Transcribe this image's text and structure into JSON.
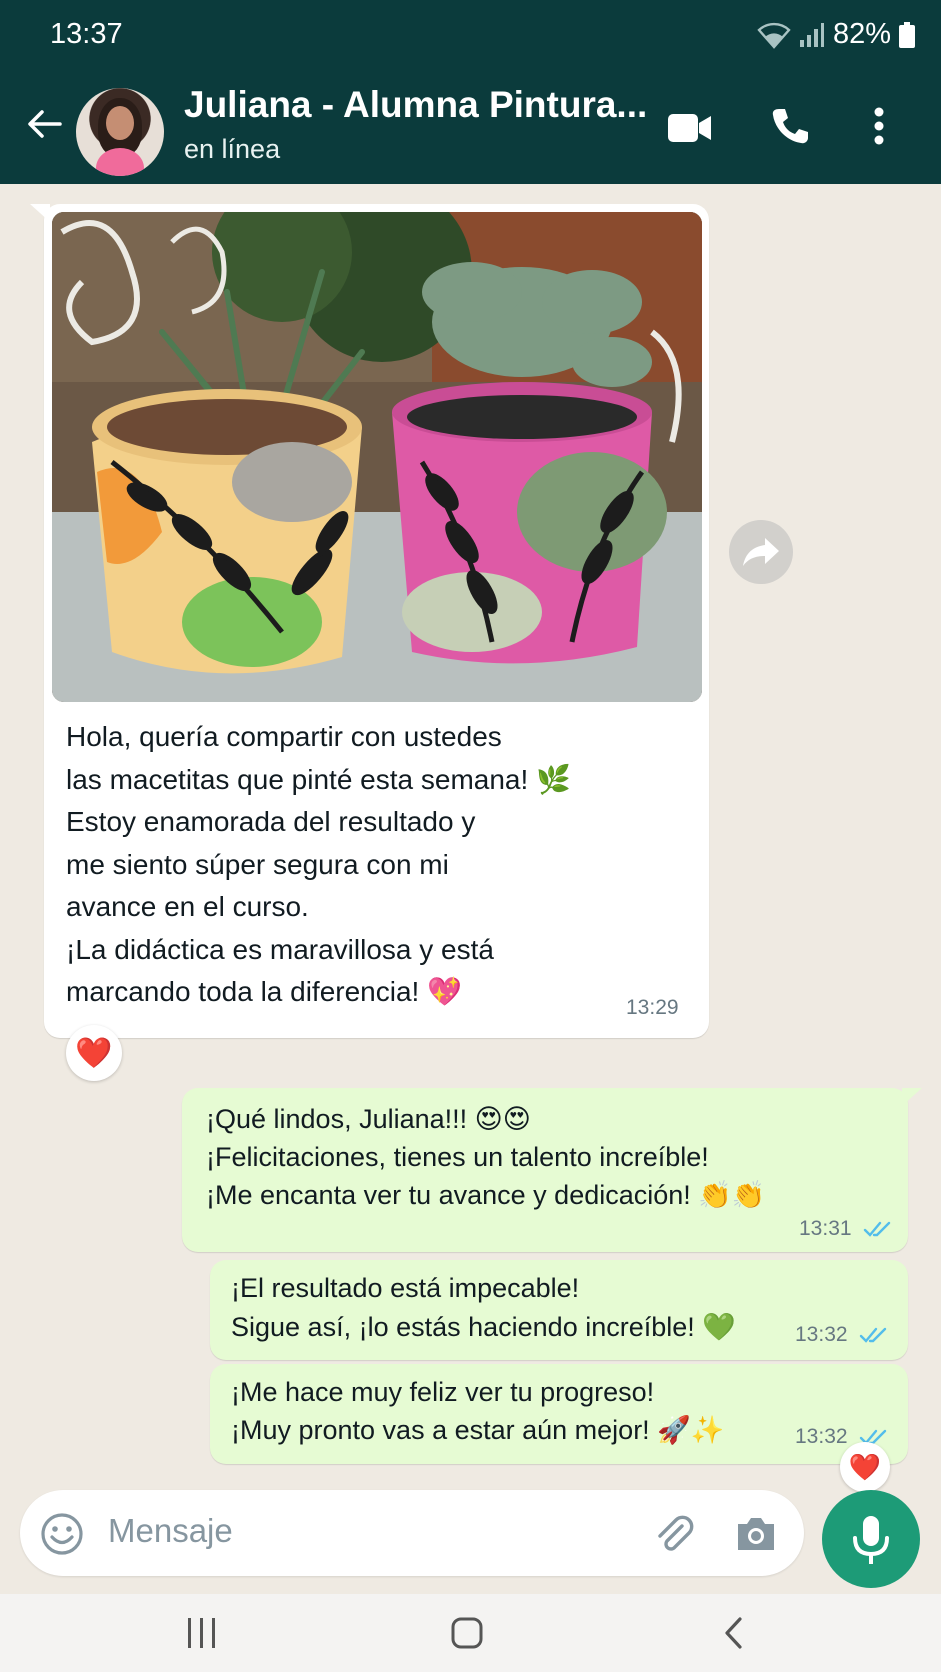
{
  "status_bar": {
    "time": "13:37",
    "battery": "82%"
  },
  "header": {
    "contact_name": "Juliana - Alumna Pintura...",
    "contact_status": "en línea"
  },
  "messages": [
    {
      "direction": "in",
      "has_image": true,
      "text": "Hola, quería compartir con ustedes\nlas macetitas que pinté esta semana! 🌿\nEstoy enamorada del resultado y\nme siento súper segura con mi\navance en el curso.\n¡La didáctica es maravillosa y está\nmarcando toda la diferencia! 💖",
      "time": "13:29",
      "reaction": "❤️"
    },
    {
      "direction": "out",
      "text": "¡Qué lindos, Juliana!!!  😍😍\n¡Felicitaciones, tienes un talento increíble!\n¡Me encanta ver tu avance y dedicación! 👏👏",
      "time": "13:31"
    },
    {
      "direction": "out",
      "text": "¡El resultado está impecable!\nSigue así, ¡lo estás haciendo increíble! 💚",
      "time": "13:32"
    },
    {
      "direction": "out",
      "text": "¡Me hace muy feliz ver tu progreso!\n¡Muy pronto vas a estar aún mejor! 🚀✨",
      "time": "13:32",
      "reaction": "❤️"
    }
  ],
  "composer": {
    "placeholder": "Mensaje"
  },
  "colors": {
    "header_bg": "#0b3b3c",
    "chat_bg": "#efeae2",
    "outgoing_bubble": "#e6fbd3",
    "incoming_bubble": "#ffffff",
    "read_ticks": "#53bdeb",
    "mic_button": "#1d9b77"
  },
  "icons": {
    "header": [
      "back-arrow-icon",
      "video-call-icon",
      "phone-icon",
      "more-vert-icon"
    ],
    "composer": [
      "emoji-icon",
      "attach-icon",
      "camera-icon",
      "mic-icon"
    ],
    "navbar": [
      "recent-apps-icon",
      "home-icon",
      "back-icon"
    ]
  }
}
